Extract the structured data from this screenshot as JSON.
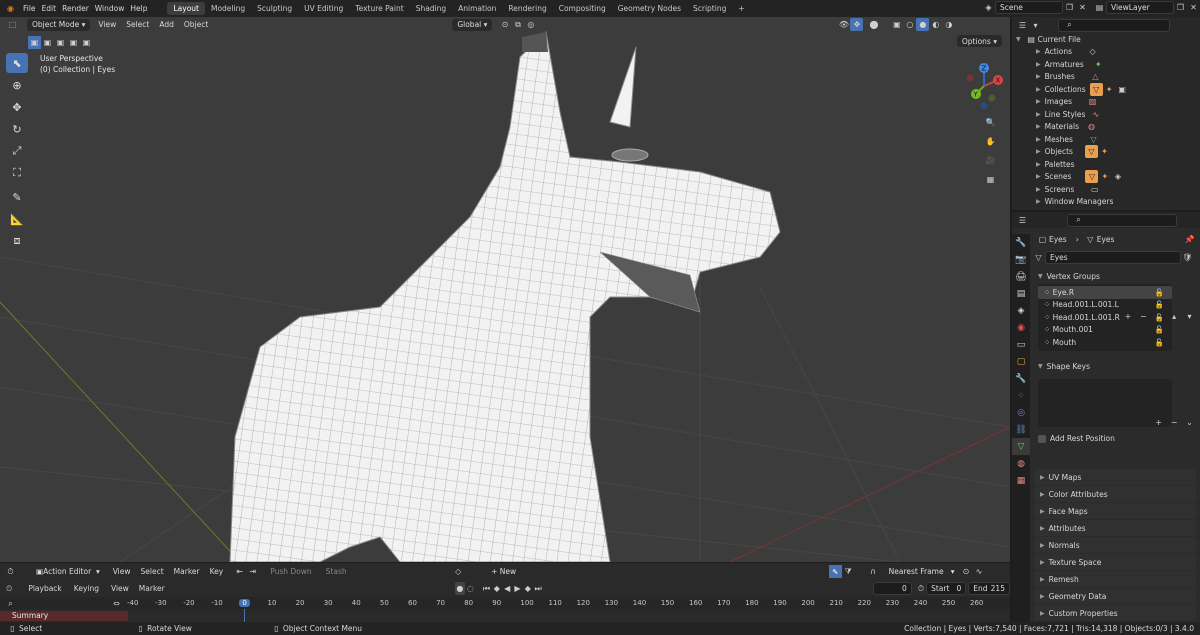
{
  "topbar": {
    "menu": [
      "File",
      "Edit",
      "Render",
      "Window",
      "Help"
    ],
    "workspaces": [
      "Layout",
      "Modeling",
      "Sculpting",
      "UV Editing",
      "Texture Paint",
      "Shading",
      "Animation",
      "Rendering",
      "Compositing",
      "Geometry Nodes",
      "Scripting"
    ],
    "active_workspace": "Layout",
    "add_tab": "+",
    "scene": "Scene",
    "view_layer": "ViewLayer"
  },
  "viewport": {
    "mode": "Object Mode",
    "menus": [
      "View",
      "Select",
      "Add",
      "Object"
    ],
    "transform": "Global",
    "options": "Options",
    "perspective": "User Perspective",
    "collection_info": "(0) Collection | Eyes",
    "axis_x": "X",
    "axis_y": "Y",
    "axis_z": "Z"
  },
  "outliner": {
    "root": "Current File",
    "items": [
      "Actions",
      "Armatures",
      "Brushes",
      "Collections",
      "Images",
      "Line Styles",
      "Materials",
      "Meshes",
      "Objects",
      "Palettes",
      "Scenes",
      "Screens",
      "Window Managers"
    ]
  },
  "properties": {
    "breadcrumb_object": "Eyes",
    "breadcrumb_mesh": "Eyes",
    "mesh_name": "Eyes",
    "vertex_groups_title": "Vertex Groups",
    "vertex_groups": [
      "Eye.R",
      "Head.001.L.001.L",
      "Head.001.L.001.R",
      "Mouth.001",
      "Mouth"
    ],
    "shape_keys_title": "Shape Keys",
    "add_rest_position": "Add Rest Position",
    "panels": [
      "UV Maps",
      "Color Attributes",
      "Face Maps",
      "Attributes",
      "Normals",
      "Texture Space",
      "Remesh",
      "Geometry Data",
      "Custom Properties"
    ]
  },
  "timeline": {
    "editor": "Action Editor",
    "menus1": [
      "View",
      "Select",
      "Marker",
      "Key"
    ],
    "push_down": "Push Down",
    "stash": "Stash",
    "new_action": "New",
    "snapping": "Nearest Frame",
    "playback": "Playback",
    "keying": "Keying",
    "menus2": [
      "View",
      "Marker"
    ],
    "current_frame": "0",
    "start_label": "Start",
    "start": "0",
    "end_label": "End",
    "end": "215",
    "summary": "Summary",
    "ticks": [
      "-40",
      "-30",
      "-20",
      "-10",
      "0",
      "10",
      "20",
      "30",
      "40",
      "50",
      "60",
      "70",
      "80",
      "90",
      "100",
      "110",
      "120",
      "130",
      "140",
      "150",
      "160",
      "170",
      "180",
      "190",
      "200",
      "210",
      "220",
      "230",
      "240",
      "250",
      "260"
    ]
  },
  "statusbar": {
    "select": "Select",
    "rotate": "Rotate View",
    "context": "Object Context Menu",
    "stats": "Collection | Eyes | Verts:7,540 | Faces:7,721 | Tris:14,318 | Objects:0/3 | 3.4.0"
  }
}
